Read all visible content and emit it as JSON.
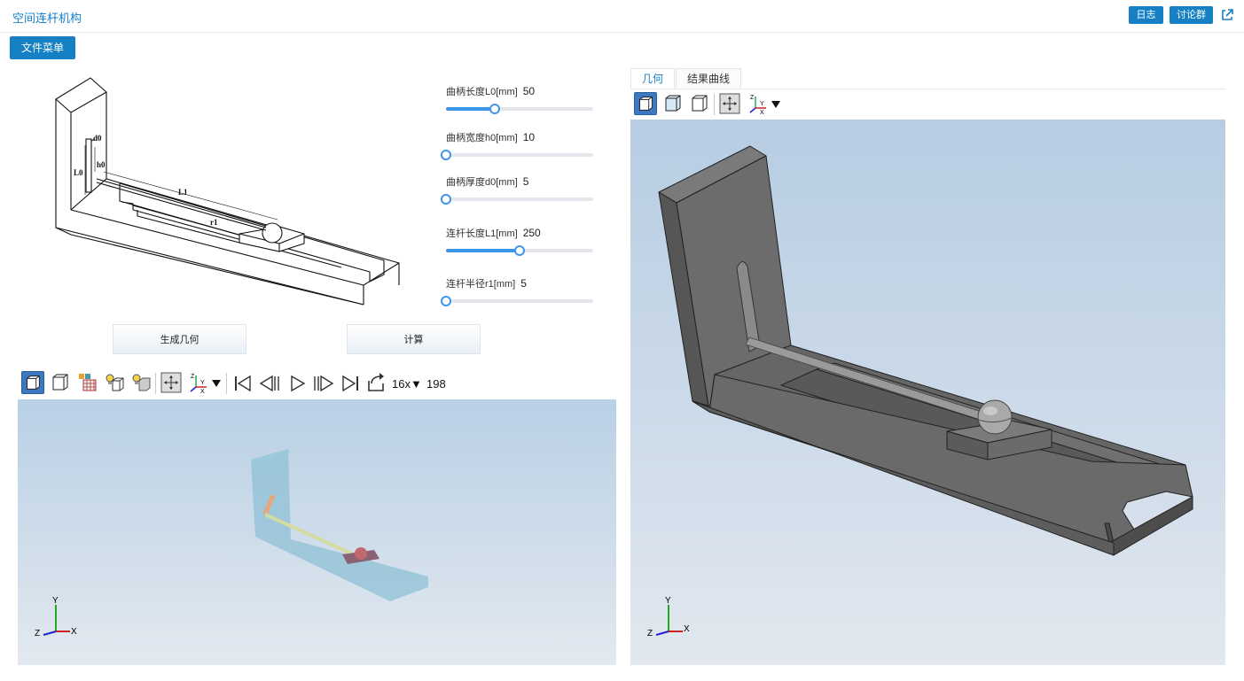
{
  "header": {
    "title": "空间连杆机构",
    "log_label": "日志",
    "group_label": "讨论群"
  },
  "file_menu_label": "文件菜单",
  "diagram": {
    "labels": {
      "d0": "d0",
      "h0": "h0",
      "L0": "L0",
      "L1": "L1",
      "r1": "r1"
    }
  },
  "params": [
    {
      "label": "曲柄长度L0[mm]",
      "value": "50",
      "fraction": 0.33
    },
    {
      "label": "曲柄宽度h0[mm]",
      "value": "10",
      "fraction": 0.0
    },
    {
      "label": "曲柄厚度d0[mm]",
      "value": "5",
      "fraction": 0.0
    },
    {
      "label": "连杆长度L1[mm]",
      "value": "250",
      "fraction": 0.5
    },
    {
      "label": "连杆半径r1[mm]",
      "value": "5",
      "fraction": 0.0
    }
  ],
  "buttons": {
    "generate": "生成几何",
    "compute": "计算"
  },
  "playback": {
    "speed": "16x▼",
    "frame": "198"
  },
  "tabs": {
    "geometry": "几何",
    "curves": "结果曲线"
  },
  "axis_labels": {
    "x": "X",
    "y": "Y",
    "z": "Z"
  },
  "colors": {
    "accent": "#1580c4",
    "slider": "#3d95ec"
  }
}
